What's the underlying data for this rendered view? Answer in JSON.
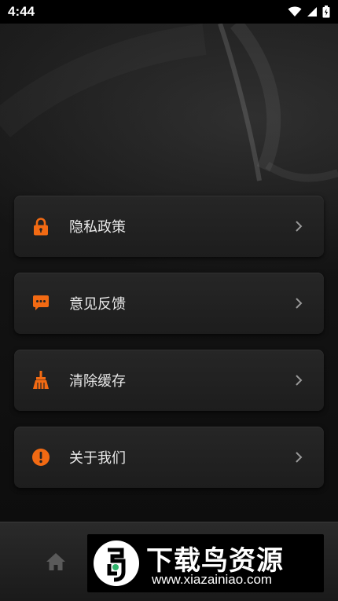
{
  "status_bar": {
    "time": "4:44"
  },
  "menu": {
    "items": [
      {
        "label": "隐私政策",
        "icon": "lock-icon"
      },
      {
        "label": "意见反馈",
        "icon": "chat-icon"
      },
      {
        "label": "清除缓存",
        "icon": "broom-icon"
      },
      {
        "label": "关于我们",
        "icon": "info-icon"
      }
    ]
  },
  "bottom_nav": {
    "home_icon": "home-icon"
  },
  "watermark": {
    "title": "下载鸟资源",
    "url": "www.xiazainiao.com"
  },
  "colors": {
    "accent": "#f26a13",
    "card": "#242424",
    "background": "#111111"
  }
}
